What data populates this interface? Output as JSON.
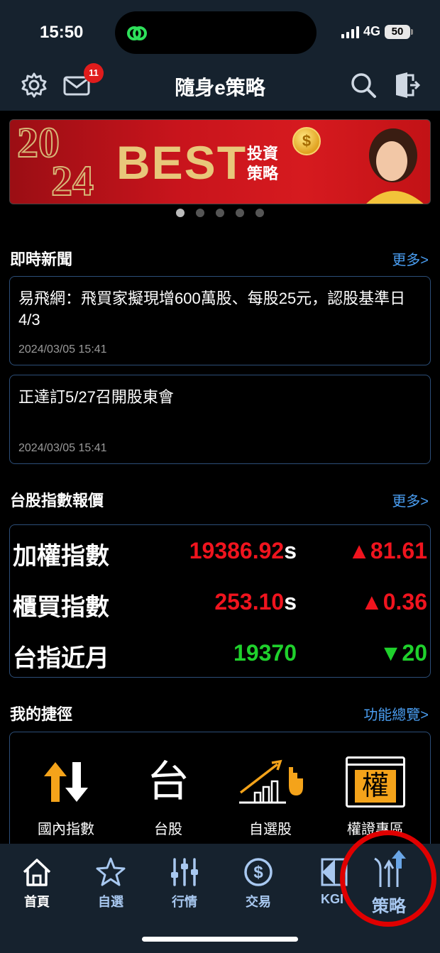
{
  "status": {
    "time": "15:50",
    "network": "4G",
    "battery": "50"
  },
  "header": {
    "title": "隨身e策略",
    "mail_badge": "11"
  },
  "banner": {
    "year_a": "20",
    "year_b": "24",
    "headline": "BEST",
    "subtitle_1": "投資",
    "subtitle_2": "策略",
    "coin_symbol": "$",
    "active_dot": 0,
    "dot_count": 5
  },
  "news": {
    "section_title": "即時新聞",
    "more": "更多>",
    "items": [
      {
        "text": "易飛網：飛買家擬現增600萬股、每股25元，認股基準日4/3",
        "time": "2024/03/05 15:41"
      },
      {
        "text": "正達訂5/27召開股東會",
        "time": "2024/03/05 15:41"
      }
    ]
  },
  "indices": {
    "section_title": "台股指數報價",
    "more": "更多>",
    "rows": [
      {
        "name": "加權指數",
        "value": "19386.92",
        "suffix": "s",
        "change": "▲81.61",
        "color": "#f0141e"
      },
      {
        "name": "櫃買指數",
        "value": "253.10",
        "suffix": "s",
        "change": "▲0.36",
        "color": "#f0141e"
      },
      {
        "name": "台指近月",
        "value": "19370",
        "suffix": "",
        "change": "▼20",
        "color": "#1fd12c"
      }
    ]
  },
  "shortcuts": {
    "section_title": "我的捷徑",
    "more": "功能總覽>",
    "items": [
      {
        "label": "國內指數",
        "icon": "up-down-arrows-icon"
      },
      {
        "label": "台股",
        "icon": "tai-character-icon",
        "glyph": "台"
      },
      {
        "label": "自選股",
        "icon": "growth-chart-icon"
      },
      {
        "label": "權證專區",
        "icon": "warrant-window-icon",
        "glyph": "權"
      }
    ]
  },
  "tabbar": {
    "tabs": [
      {
        "label": "首頁",
        "icon": "home-icon"
      },
      {
        "label": "自選",
        "icon": "star-icon"
      },
      {
        "label": "行情",
        "icon": "sliders-icon"
      },
      {
        "label": "交易",
        "icon": "dollar-icon"
      },
      {
        "label": "KGI",
        "icon": "kgi-logo-icon"
      },
      {
        "label": "策略",
        "icon": "strategy-arrows-icon"
      }
    ]
  },
  "colors": {
    "accent_blue": "#4a9ef2",
    "up_red": "#f0141e",
    "down_green": "#1fd12c",
    "bar_bg": "#16222e",
    "card_border": "#2c4e78"
  }
}
